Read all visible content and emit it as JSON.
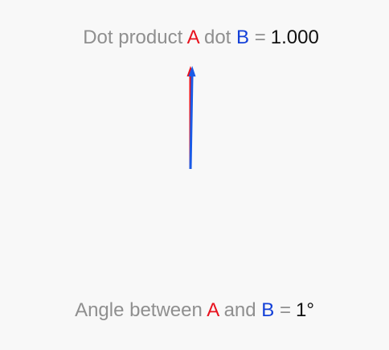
{
  "top_line": {
    "prefix": "Dot product",
    "a": "A",
    "mid": "dot",
    "b": "B",
    "eq": "=",
    "value": "1.000"
  },
  "bottom_line": {
    "prefix": "Angle between",
    "a": "A",
    "mid": "and",
    "b": "B",
    "eq": "=",
    "value": "1°"
  },
  "vectors": {
    "a": {
      "angle_deg": 90,
      "length": 1.0,
      "color": "#e8121e"
    },
    "b": {
      "angle_deg": 89,
      "length": 1.0,
      "color": "#1a5ae6"
    }
  }
}
